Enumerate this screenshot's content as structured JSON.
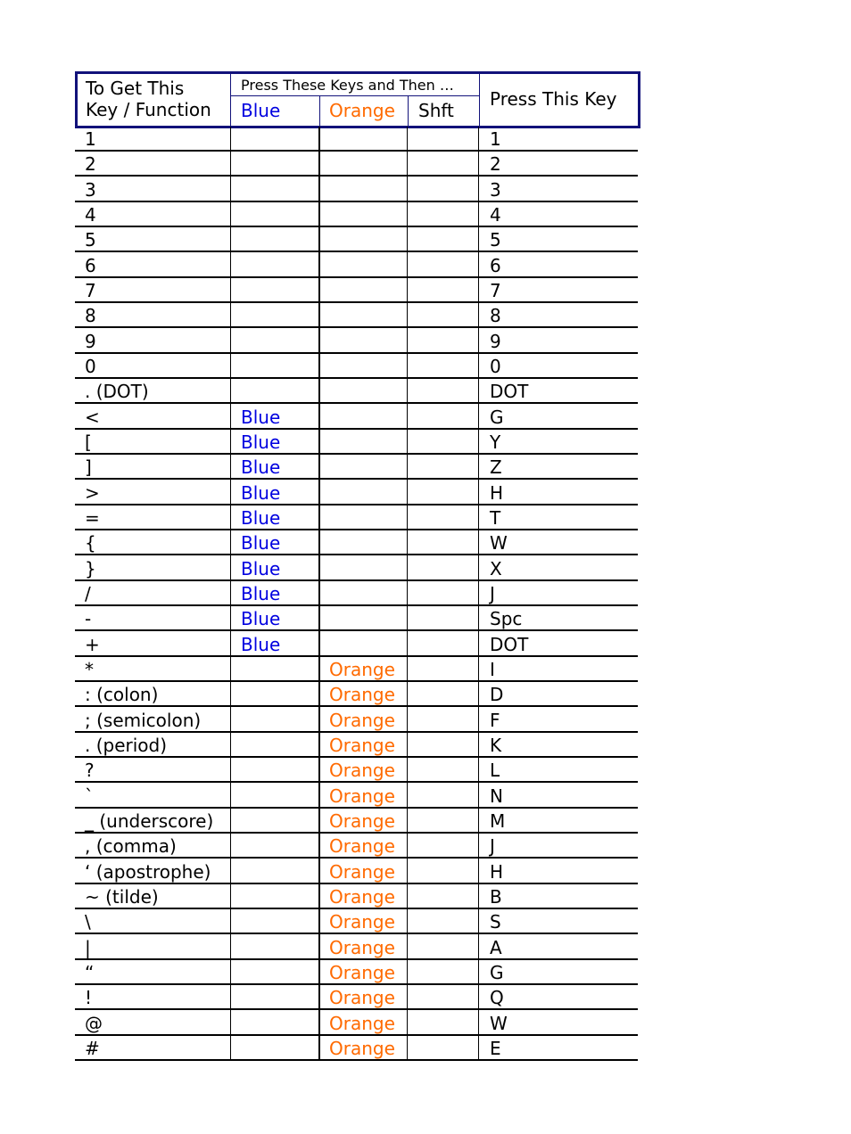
{
  "header": {
    "col1": "To Get This Key / Function",
    "col1_line1": "To Get This",
    "col1_line2": "Key / Function",
    "group": "Press These Keys and Then …",
    "blue": "Blue",
    "orange": "Orange",
    "shift": "Shft",
    "press": "Press This Key"
  },
  "colors": {
    "blue": "#0000e0",
    "orange": "#ff6a00",
    "border": "#12127a"
  },
  "rows": [
    {
      "key": "1",
      "blue": "",
      "orange": "",
      "shft": "",
      "press": "1"
    },
    {
      "key": "2",
      "blue": "",
      "orange": "",
      "shft": "",
      "press": "2"
    },
    {
      "key": "3",
      "blue": "",
      "orange": "",
      "shft": "",
      "press": "3"
    },
    {
      "key": "4",
      "blue": "",
      "orange": "",
      "shft": "",
      "press": "4"
    },
    {
      "key": "5",
      "blue": "",
      "orange": "",
      "shft": "",
      "press": "5"
    },
    {
      "key": "6",
      "blue": "",
      "orange": "",
      "shft": "",
      "press": "6"
    },
    {
      "key": "7",
      "blue": "",
      "orange": "",
      "shft": "",
      "press": "7"
    },
    {
      "key": "8",
      "blue": "",
      "orange": "",
      "shft": "",
      "press": "8"
    },
    {
      "key": "9",
      "blue": "",
      "orange": "",
      "shft": "",
      "press": "9"
    },
    {
      "key": "0",
      "blue": "",
      "orange": "",
      "shft": "",
      "press": "0"
    },
    {
      "key": ". (DOT)",
      "blue": "",
      "orange": "",
      "shft": "",
      "press": "DOT"
    },
    {
      "key": "<",
      "blue": "Blue",
      "orange": "",
      "shft": "",
      "press": "G"
    },
    {
      "key": "[",
      "blue": "Blue",
      "orange": "",
      "shft": "",
      "press": "Y"
    },
    {
      "key": "]",
      "blue": "Blue",
      "orange": "",
      "shft": "",
      "press": "Z"
    },
    {
      "key": ">",
      "blue": "Blue",
      "orange": "",
      "shft": "",
      "press": "H"
    },
    {
      "key": "=",
      "blue": "Blue",
      "orange": "",
      "shft": "",
      "press": "T"
    },
    {
      "key": "{",
      "blue": "Blue",
      "orange": "",
      "shft": "",
      "press": "W"
    },
    {
      "key": "}",
      "blue": "Blue",
      "orange": "",
      "shft": "",
      "press": "X"
    },
    {
      "key": "/",
      "blue": "Blue",
      "orange": "",
      "shft": "",
      "press": "J"
    },
    {
      "key": "-",
      "blue": "Blue",
      "orange": "",
      "shft": "",
      "press": "Spc"
    },
    {
      "key": "+",
      "blue": "Blue",
      "orange": "",
      "shft": "",
      "press": "DOT"
    },
    {
      "key": "*",
      "blue": "",
      "orange": "Orange",
      "shft": "",
      "press": "I"
    },
    {
      "key": ": (colon)",
      "blue": "",
      "orange": "Orange",
      "shft": "",
      "press": "D"
    },
    {
      "key": "; (semicolon)",
      "blue": "",
      "orange": "Orange",
      "shft": "",
      "press": "F"
    },
    {
      "key": ". (period)",
      "blue": "",
      "orange": "Orange",
      "shft": "",
      "press": "K"
    },
    {
      "key": "?",
      "blue": "",
      "orange": "Orange",
      "shft": "",
      "press": "L"
    },
    {
      "key": "`",
      "blue": "",
      "orange": "Orange",
      "shft": "",
      "press": "N"
    },
    {
      "key": "_ (underscore)",
      "blue": "",
      "orange": "Orange",
      "shft": "",
      "press": "M"
    },
    {
      "key": ", (comma)",
      "blue": "",
      "orange": "Orange",
      "shft": "",
      "press": "J"
    },
    {
      "key": "‘ (apostrophe)",
      "blue": "",
      "orange": "Orange",
      "shft": "",
      "press": "H"
    },
    {
      "key": "~ (tilde)",
      "blue": "",
      "orange": "Orange",
      "shft": "",
      "press": "B"
    },
    {
      "key": "\\",
      "blue": "",
      "orange": "Orange",
      "shft": "",
      "press": "S"
    },
    {
      "key": "|",
      "blue": "",
      "orange": "Orange",
      "shft": "",
      "press": "A"
    },
    {
      "key": "“",
      "blue": "",
      "orange": "Orange",
      "shft": "",
      "press": "G"
    },
    {
      "key": "!",
      "blue": "",
      "orange": "Orange",
      "shft": "",
      "press": "Q"
    },
    {
      "key": "@",
      "blue": "",
      "orange": "Orange",
      "shft": "",
      "press": "W"
    },
    {
      "key": "#",
      "blue": "",
      "orange": "Orange",
      "shft": "",
      "press": "E"
    }
  ]
}
